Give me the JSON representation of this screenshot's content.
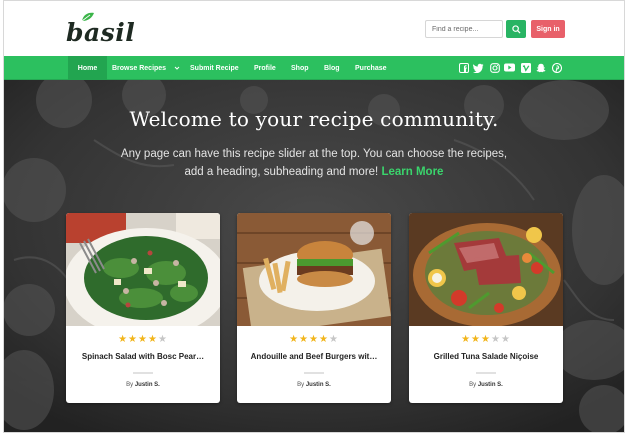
{
  "brand": {
    "logo_text": "basil"
  },
  "header": {
    "search_placeholder": "Find a recipe...",
    "signin_label": "Sign in"
  },
  "nav": {
    "items": [
      "Home",
      "Browse Recipes",
      "Submit Recipe",
      "Profile",
      "Shop",
      "Blog",
      "Purchase"
    ],
    "social_icons": [
      "facebook-icon",
      "twitter-icon",
      "instagram-icon",
      "youtube-icon",
      "vimeo-icon",
      "snapchat-icon",
      "pinterest-icon"
    ]
  },
  "hero": {
    "title": "Welcome to your recipe community.",
    "subtitle": "Any page can have this recipe slider at the top. You can choose the recipes, add a heading, subheading and more!",
    "link": "Learn More"
  },
  "cards": [
    {
      "title": "Spinach Salad with Bosc Pear…",
      "rating": 4,
      "by": "By",
      "author": "Justin S."
    },
    {
      "title": "Andouille and Beef Burgers wit…",
      "rating": 4,
      "by": "By",
      "author": "Justin S."
    },
    {
      "title": "Grilled Tuna Salade Niçoise",
      "rating": 3,
      "by": "By",
      "author": "Justin S."
    }
  ],
  "colors": {
    "accent": "#2cc05f",
    "signin": "#e8606a",
    "star": "#f2b51b",
    "link": "#3ad46c"
  }
}
